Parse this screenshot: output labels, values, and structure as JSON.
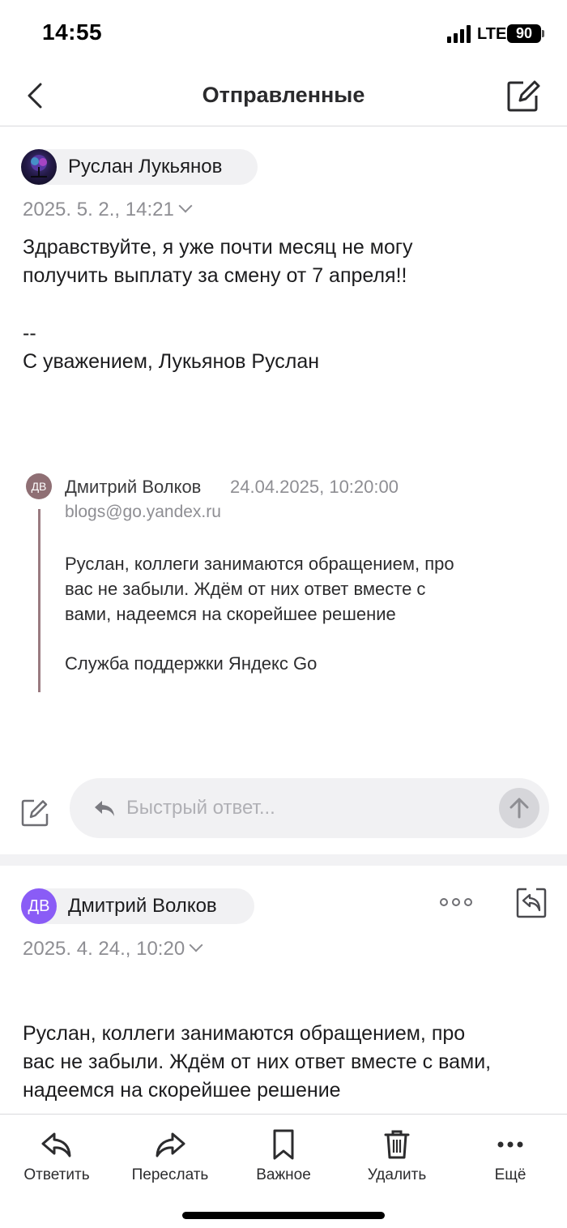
{
  "status_bar": {
    "time": "14:55",
    "network": "LTE",
    "battery": "90"
  },
  "header": {
    "title": "Отправленные"
  },
  "message1": {
    "sender": "Руслан Лукьянов",
    "date": "2025. 5. 2., 14:21",
    "body_lines": [
      "Здравствуйте, я уже почти месяц не могу",
      "получить выплату за смену от 7 апреля!!",
      "--",
      "С уважением, Лукьянов Руслан"
    ],
    "quote": {
      "initials": "ДВ",
      "sender": "Дмитрий Волков",
      "date": "24.04.2025, 10:20:00",
      "email": "blogs@go.yandex.ru",
      "lines": [
        "Руслан, коллеги занимаются обращением, про",
        "вас не забыли. Ждём от них ответ вместе с",
        "вами, надеемся на скорейшее решение",
        "Служба поддержки Яндекс Go"
      ]
    }
  },
  "quick_reply": {
    "placeholder": "Быстрый ответ..."
  },
  "message2": {
    "initials": "ДВ",
    "sender": "Дмитрий Волков",
    "date": "2025. 4. 24., 10:20",
    "body_lines": [
      "Руслан, коллеги занимаются обращением, про",
      "вас не забыли. Ждём от них ответ вместе с вами,",
      "надеемся на скорейшее решение"
    ]
  },
  "toolbar": {
    "items": [
      {
        "label": "Ответить",
        "icon": "reply-icon"
      },
      {
        "label": "Переслать",
        "icon": "forward-icon"
      },
      {
        "label": "Важное",
        "icon": "bookmark-icon"
      },
      {
        "label": "Удалить",
        "icon": "trash-icon"
      },
      {
        "label": "Ещё",
        "icon": "more-icon"
      }
    ]
  }
}
